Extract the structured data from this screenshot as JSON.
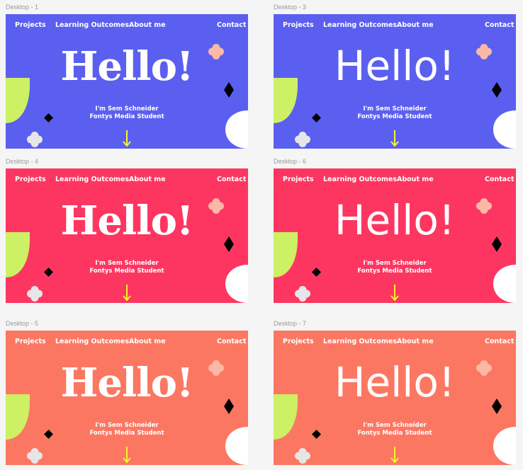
{
  "frames": [
    {
      "label": "Desktop - 1",
      "bg": "#5b5ff0",
      "style": "slab"
    },
    {
      "label": "Desktop - 3",
      "bg": "#5b5ff0",
      "style": "round"
    },
    {
      "label": "Desktop - 4",
      "bg": "#fd3661",
      "style": "slab"
    },
    {
      "label": "Desktop - 6",
      "bg": "#fd3661",
      "style": "round"
    },
    {
      "label": "Desktop - 5",
      "bg": "#fc7762",
      "style": "slab"
    },
    {
      "label": "Desktop - 7",
      "bg": "#fc7762",
      "style": "round"
    }
  ],
  "nav": {
    "projects": "Projects",
    "learning": "Learning Outcomes",
    "about": "About me",
    "contact": "Contact"
  },
  "hero": {
    "title": "Hello!",
    "line1": "I'm Sem Schneider",
    "line2": "Fontys Media Student"
  },
  "colors": {
    "lime": "#cdf065",
    "flower_pink": "#fbb8a6",
    "flower_grey": "#e6e6e6",
    "arrow": "#f5f52a",
    "diamond": "#000000",
    "half_circle": "#ffffff"
  },
  "icons": [
    "flower-icon",
    "diamond-icon",
    "leaf-shape-icon",
    "half-circle-icon",
    "arrow-down-icon"
  ]
}
